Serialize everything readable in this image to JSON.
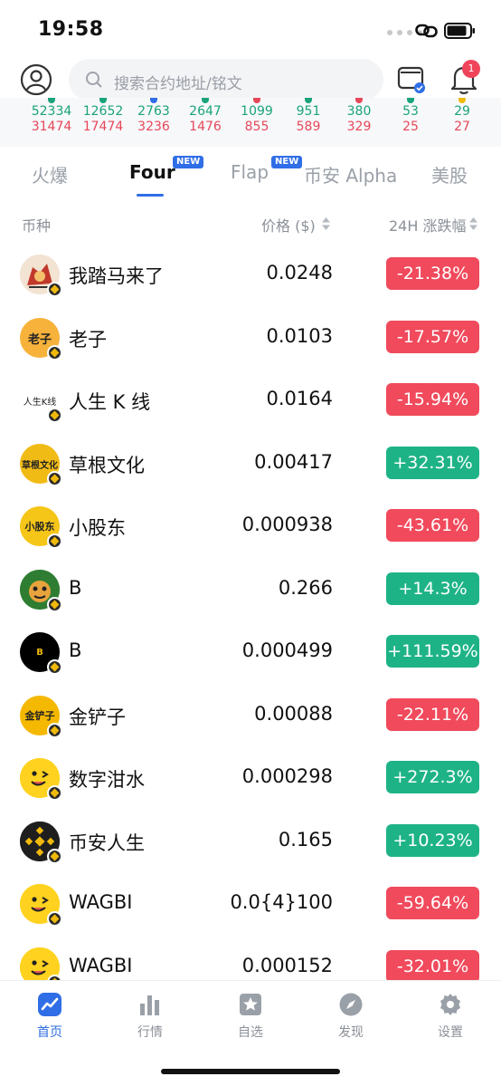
{
  "status": {
    "time": "19:58"
  },
  "search": {
    "placeholder": "搜索合约地址/铭文"
  },
  "badge_count": "1",
  "stats": [
    {
      "up": "52334",
      "down": "31474",
      "mark": "#1aa37a"
    },
    {
      "up": "12652",
      "down": "17474",
      "mark": "#1aa37a"
    },
    {
      "up": "2763",
      "down": "3236",
      "mark": "#2f6ee6"
    },
    {
      "up": "2647",
      "down": "1476",
      "mark": "#1aa37a"
    },
    {
      "up": "1099",
      "down": "855",
      "mark": "#e6475a"
    },
    {
      "up": "951",
      "down": "589",
      "mark": "#1aa37a"
    },
    {
      "up": "380",
      "down": "329",
      "mark": "#e6475a"
    },
    {
      "up": "53",
      "down": "25",
      "mark": "#1aa37a"
    },
    {
      "up": "29",
      "down": "27",
      "mark": "#f0b90b"
    }
  ],
  "tabs": [
    {
      "label": "火爆"
    },
    {
      "label": "Four",
      "badge": "NEW"
    },
    {
      "label": "Flap",
      "badge": "NEW"
    },
    {
      "label": "币安 Alpha"
    },
    {
      "label": "美股"
    }
  ],
  "columns": {
    "coin": "币种",
    "price": "价格 ($)",
    "change": "24H 涨跌幅"
  },
  "rows": [
    {
      "name": "我踏马来了",
      "price": "0.0248",
      "change": "-21.38%",
      "trend": "down"
    },
    {
      "name": "老子",
      "price": "0.0103",
      "change": "-17.57%",
      "trend": "down",
      "logo_text": "老子"
    },
    {
      "name": "人生 K 线",
      "price": "0.0164",
      "change": "-15.94%",
      "trend": "down",
      "logo_text": "人生K线"
    },
    {
      "name": "草根文化",
      "price": "0.00417",
      "change": "+32.31%",
      "trend": "up",
      "logo_text": "草根文化"
    },
    {
      "name": "小股东",
      "price": "0.000938",
      "change": "-43.61%",
      "trend": "down",
      "logo_text": "小股东"
    },
    {
      "name": "B",
      "price": "0.266",
      "change": "+14.3%",
      "trend": "up"
    },
    {
      "name": "B",
      "price": "0.000499",
      "change": "+111.59%",
      "trend": "up",
      "logo_text": "B"
    },
    {
      "name": "金铲子",
      "price": "0.00088",
      "change": "-22.11%",
      "trend": "down",
      "logo_text": "金铲子"
    },
    {
      "name": "数字泔水",
      "price": "0.000298",
      "change": "+272.3%",
      "trend": "up"
    },
    {
      "name": "币安人生",
      "price": "0.165",
      "change": "+10.23%",
      "trend": "up"
    },
    {
      "name": "WAGBI",
      "price": "0.0{4}100",
      "change": "-59.64%",
      "trend": "down"
    },
    {
      "name": "WAGBI",
      "price": "0.000152",
      "change": "-32.01%",
      "trend": "down"
    }
  ],
  "nav": [
    {
      "label": "首页",
      "icon": "chart-line-icon"
    },
    {
      "label": "行情",
      "icon": "bar-chart-icon"
    },
    {
      "label": "自选",
      "icon": "star-icon"
    },
    {
      "label": "发现",
      "icon": "compass-icon"
    },
    {
      "label": "设置",
      "icon": "gear-icon"
    }
  ]
}
